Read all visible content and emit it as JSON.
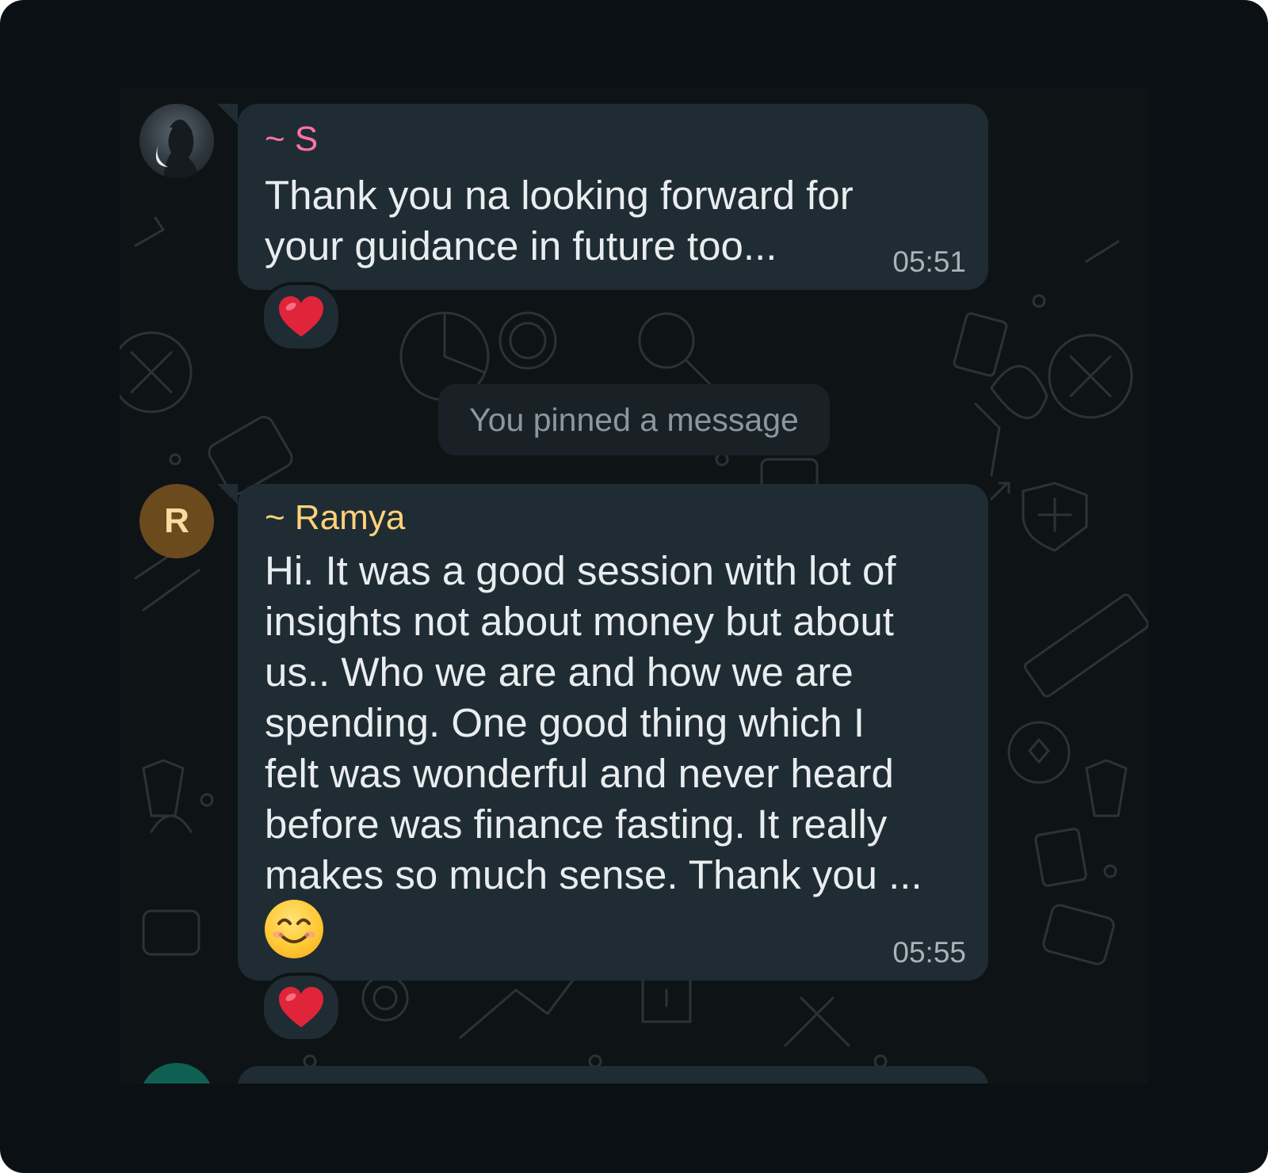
{
  "messages": [
    {
      "sender": "~ S",
      "sender_color": "#ff72a7",
      "lines": [
        "Thank you na looking forward for",
        "your guidance in future too..."
      ],
      "time": "05:51",
      "reaction": "red-heart"
    },
    {
      "avatar_initial": "R",
      "sender": "~ Ramya",
      "sender_color": "#ffd279",
      "lines": [
        "Hi. It was a good session with lot of",
        "insights not about money but about",
        "us.. Who we are and how we are",
        "spending. One good thing which I",
        "felt was wonderful and never heard",
        "before was finance fasting. It really",
        "makes so much sense. Thank you ..."
      ],
      "emoji": "smiling-face",
      "time": "05:55",
      "reaction": "red-heart"
    }
  ],
  "system_message": "You pinned a message",
  "colors": {
    "bubble": "#202c33",
    "chat_background": "#0e1316",
    "system_text": "#8c979d",
    "heart": "#e0243a"
  }
}
